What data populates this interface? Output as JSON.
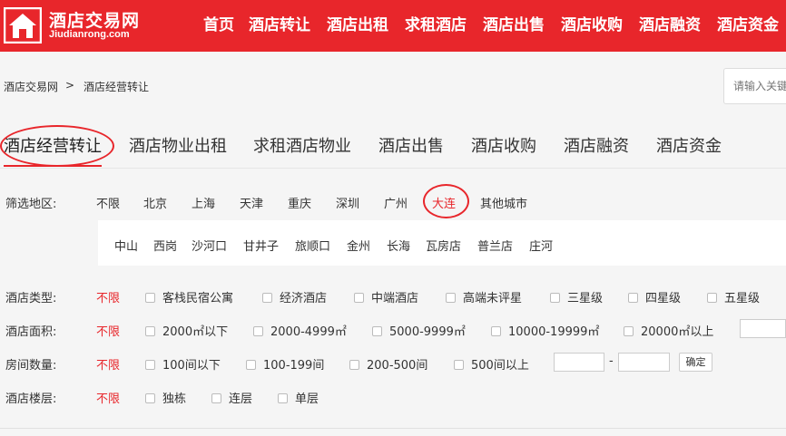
{
  "brand": {
    "title": "酒店交易网",
    "domain": "Jiudianrong.com",
    "color": "#e8262b"
  },
  "nav": [
    "首页",
    "酒店转让",
    "酒店出租",
    "求租酒店",
    "酒店出售",
    "酒店收购",
    "酒店融资",
    "酒店资金"
  ],
  "breadcrumb": {
    "home": "酒店交易网",
    "separator": ">",
    "current": "酒店经营转让"
  },
  "search": {
    "placeholder": "请输入关键"
  },
  "tabs": [
    "酒店经营转让",
    "酒店物业出租",
    "求租酒店物业",
    "酒店出售",
    "酒店收购",
    "酒店融资",
    "酒店资金"
  ],
  "filters": {
    "region": {
      "label": "筛选地区:",
      "options": [
        "不限",
        "北京",
        "上海",
        "天津",
        "重庆",
        "深圳",
        "广州",
        "大连",
        "其他城市"
      ],
      "selected": "大连",
      "sub_options": [
        "中山",
        "西岗",
        "沙河口",
        "甘井子",
        "旅顺口",
        "金州",
        "长海",
        "瓦房店",
        "普兰店",
        "庄河"
      ]
    },
    "type": {
      "label": "酒店类型:",
      "any": "不限",
      "options": [
        "客栈民宿公寓",
        "经济酒店",
        "中端酒店",
        "高端未评星",
        "三星级",
        "四星级",
        "五星级"
      ]
    },
    "area": {
      "label": "酒店面积:",
      "any": "不限",
      "options": [
        "2000㎡以下",
        "2000-4999㎡",
        "5000-9999㎡",
        "10000-19999㎡",
        "20000㎡以上"
      ]
    },
    "rooms": {
      "label": "房间数量:",
      "any": "不限",
      "options": [
        "100间以下",
        "100-199间",
        "200-500间",
        "500间以上"
      ],
      "range_separator": "-",
      "confirm": "确定"
    },
    "floors": {
      "label": "酒店楼层:",
      "any": "不限",
      "options": [
        "独栋",
        "连层",
        "单层"
      ]
    }
  }
}
